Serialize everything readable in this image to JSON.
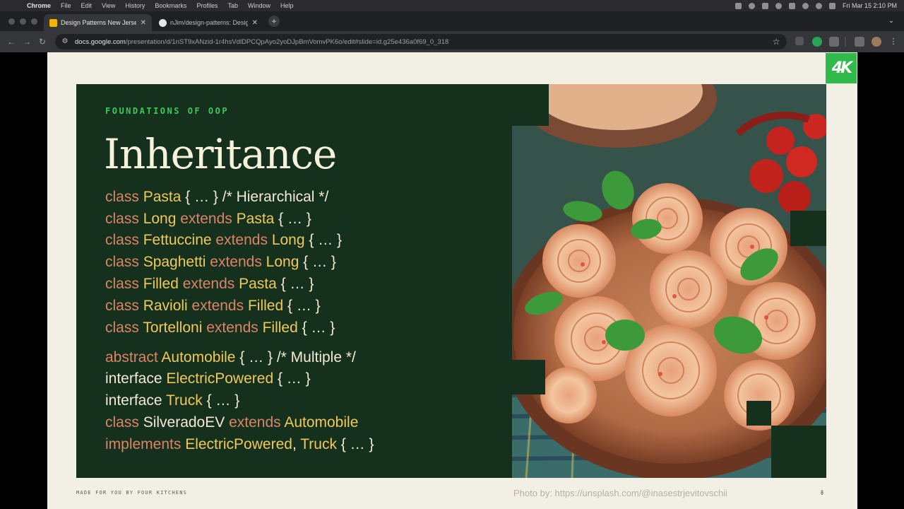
{
  "menubar": {
    "app": "Chrome",
    "items": [
      "File",
      "Edit",
      "View",
      "History",
      "Bookmarks",
      "Profiles",
      "Tab",
      "Window",
      "Help"
    ],
    "clock": "Fri Mar 15  2:10 PM"
  },
  "tabs": [
    {
      "title": "Design Patterns New Jersey D",
      "favicon": "slides-icon"
    },
    {
      "title": "nJim/design-patterns: Design",
      "favicon": "github-icon"
    }
  ],
  "toolbar": {
    "url_domain": "docs.google.com",
    "url_path": "/presentation/d/1nST9xANzid-1r4hsVdlDPCQpAyo2yoDJpBmVomvPK6o/edit#slide=id.g25e436a0f69_0_318"
  },
  "slide": {
    "kicker": "FOUNDATIONS OF OOP",
    "title": "Inheritance",
    "badge": "4K",
    "footer_left": "MADE FOR YOU BY FOUR KITCHENS",
    "photo_credit": "Photo by: https://unsplash.com/@inasestrjevitovschii",
    "code_lines": [
      [
        {
          "t": "class ",
          "c": "kw"
        },
        {
          "t": "Pasta",
          "c": "ty"
        },
        {
          "t": " { … }     /* Hierarchical */",
          "c": "pl"
        }
      ],
      [
        {
          "t": "class ",
          "c": "kw"
        },
        {
          "t": "Long",
          "c": "ty"
        },
        {
          "t": " extends ",
          "c": "kw"
        },
        {
          "t": "Pasta",
          "c": "ty"
        },
        {
          "t": " { … }",
          "c": "pl"
        }
      ],
      [
        {
          "t": "class ",
          "c": "kw"
        },
        {
          "t": "Fettuccine",
          "c": "ty"
        },
        {
          "t": " extends ",
          "c": "kw"
        },
        {
          "t": "Long",
          "c": "ty"
        },
        {
          "t": " { … }",
          "c": "pl"
        }
      ],
      [
        {
          "t": "class ",
          "c": "kw"
        },
        {
          "t": "Spaghetti",
          "c": "ty"
        },
        {
          "t": " extends ",
          "c": "kw"
        },
        {
          "t": "Long",
          "c": "ty"
        },
        {
          "t": " { … }",
          "c": "pl"
        }
      ],
      [
        {
          "t": "class ",
          "c": "kw"
        },
        {
          "t": "Filled",
          "c": "ty"
        },
        {
          "t": " extends ",
          "c": "kw"
        },
        {
          "t": "Pasta",
          "c": "ty"
        },
        {
          "t": " { … }",
          "c": "pl"
        }
      ],
      [
        {
          "t": "class ",
          "c": "kw"
        },
        {
          "t": "Ravioli",
          "c": "ty"
        },
        {
          "t": " extends ",
          "c": "kw"
        },
        {
          "t": "Filled",
          "c": "ty"
        },
        {
          "t": " { … }",
          "c": "pl"
        }
      ],
      [
        {
          "t": "class ",
          "c": "kw"
        },
        {
          "t": "Tortelloni",
          "c": "ty"
        },
        {
          "t": " extends ",
          "c": "kw"
        },
        {
          "t": "Filled",
          "c": "ty"
        },
        {
          "t": " { … }",
          "c": "pl"
        }
      ],
      [
        {
          "t": "abstract ",
          "c": "kw"
        },
        {
          "t": "Automobile",
          "c": "ty"
        },
        {
          "t": " { … }     /* Multiple */",
          "c": "pl"
        }
      ],
      [
        {
          "t": "interface ",
          "c": "pl"
        },
        {
          "t": "ElectricPowered",
          "c": "ty"
        },
        {
          "t": " { … }",
          "c": "pl"
        }
      ],
      [
        {
          "t": "interface ",
          "c": "pl"
        },
        {
          "t": "Truck",
          "c": "ty"
        },
        {
          "t": " { … }",
          "c": "pl"
        }
      ],
      [
        {
          "t": "class ",
          "c": "kw"
        },
        {
          "t": "SilveradoEV",
          "c": "pl"
        },
        {
          "t": " extends ",
          "c": "kw"
        },
        {
          "t": "Automobile",
          "c": "ty"
        }
      ],
      [
        {
          "t": "   implements ",
          "c": "kw"
        },
        {
          "t": "ElectricPowered",
          "c": "ty"
        },
        {
          "t": ", ",
          "c": "pl"
        },
        {
          "t": "Truck",
          "c": "ty"
        },
        {
          "t": " { … }",
          "c": "pl"
        }
      ]
    ]
  },
  "colors": {
    "panel": "#15301c",
    "keyword": "#dc8468",
    "type": "#f0c95a",
    "plain": "#f2ead4",
    "accent_green": "#3fc75a"
  }
}
